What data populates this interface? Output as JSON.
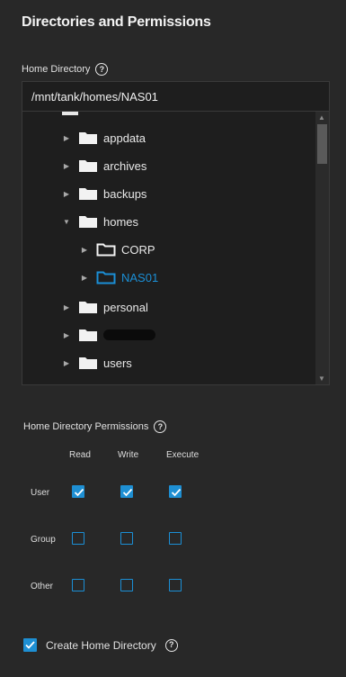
{
  "section": {
    "title": "Directories and Permissions"
  },
  "home_directory": {
    "label": "Home Directory",
    "value": "/mnt/tank/homes/NAS01"
  },
  "tree": {
    "items": [
      {
        "label": "appdata",
        "expanded": false,
        "selected": false
      },
      {
        "label": "archives",
        "expanded": false,
        "selected": false
      },
      {
        "label": "backups",
        "expanded": false,
        "selected": false
      },
      {
        "label": "homes",
        "expanded": true,
        "selected": false
      },
      {
        "label": "CORP",
        "expanded": false,
        "selected": false
      },
      {
        "label": "NAS01",
        "expanded": false,
        "selected": true
      },
      {
        "label": "personal",
        "expanded": false,
        "selected": false
      },
      {
        "label": "",
        "expanded": false,
        "selected": false,
        "redacted": true
      },
      {
        "label": "users",
        "expanded": false,
        "selected": false
      }
    ]
  },
  "permissions": {
    "label": "Home Directory Permissions",
    "columns": [
      "Read",
      "Write",
      "Execute"
    ],
    "rows": [
      {
        "label": "User",
        "values": [
          true,
          true,
          true
        ]
      },
      {
        "label": "Group",
        "values": [
          false,
          false,
          false
        ]
      },
      {
        "label": "Other",
        "values": [
          false,
          false,
          false
        ]
      }
    ]
  },
  "create_home": {
    "label": "Create Home Directory",
    "checked": true
  },
  "colors": {
    "accent": "#1e8fd3",
    "background": "#282828",
    "input_bg": "#1e1e1e",
    "selected_text": "#1b8fd6"
  }
}
